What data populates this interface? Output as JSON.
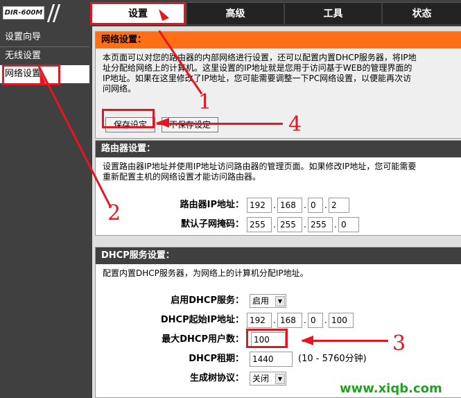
{
  "header": {
    "logo": "DIR-600M",
    "tabs": [
      "设置",
      "高级",
      "工具",
      "状态"
    ]
  },
  "sidebar": {
    "items": [
      "设置向导",
      "无线设置",
      "网络设置"
    ]
  },
  "network": {
    "title": "网络设置：",
    "desc": [
      "本页面可以对您的路由器的内部网络进行设置，还可以配置内置DHCP服务器，将IP地",
      "址分配给网络上的计算机。这里设置的IP地址就是您用于访问基于WEB的管理界面的",
      "IP地址。如果在这里修改了IP地址，您可能需要调整一下PC网络设置，以便能再次访",
      "问网络。"
    ],
    "save_label": "保存设定",
    "nosave_label": "不保存设定"
  },
  "router": {
    "title": "路由器设置：",
    "desc": [
      "设置路由器IP地址并使用IP地址访问路由器的管理页面。如果修改IP地址，您可能需要",
      "重新配置主机的网络设置才能访问路由器。"
    ],
    "ip_label": "路由器IP地址：",
    "ip": [
      "192",
      "168",
      "0",
      "2"
    ],
    "mask_label": "默认子网掩码：",
    "mask": [
      "255",
      "255",
      "255",
      "0"
    ]
  },
  "dhcp": {
    "title": "DHCP服务设置：",
    "desc": "配置内置DHCP服务器，为网络上的计算机分配IP地址。",
    "enable_label": "启用DHCP服务：",
    "enable_value": "启用",
    "start_label": "DHCP起始IP地址：",
    "start_ip": [
      "192",
      "168",
      "0",
      "100"
    ],
    "max_label": "最大DHCP用户数：",
    "max_value": "100",
    "lease_label": "DHCP租期：",
    "lease_value": "1440",
    "lease_hint": "(10 - 5760分钟)",
    "stp_label": "生成树协议：",
    "stp_value": "关闭"
  },
  "annotations": {
    "numbers": [
      "1",
      "2",
      "3",
      "4"
    ],
    "color": "#e8141e"
  },
  "watermark": "www.xiqb.com"
}
